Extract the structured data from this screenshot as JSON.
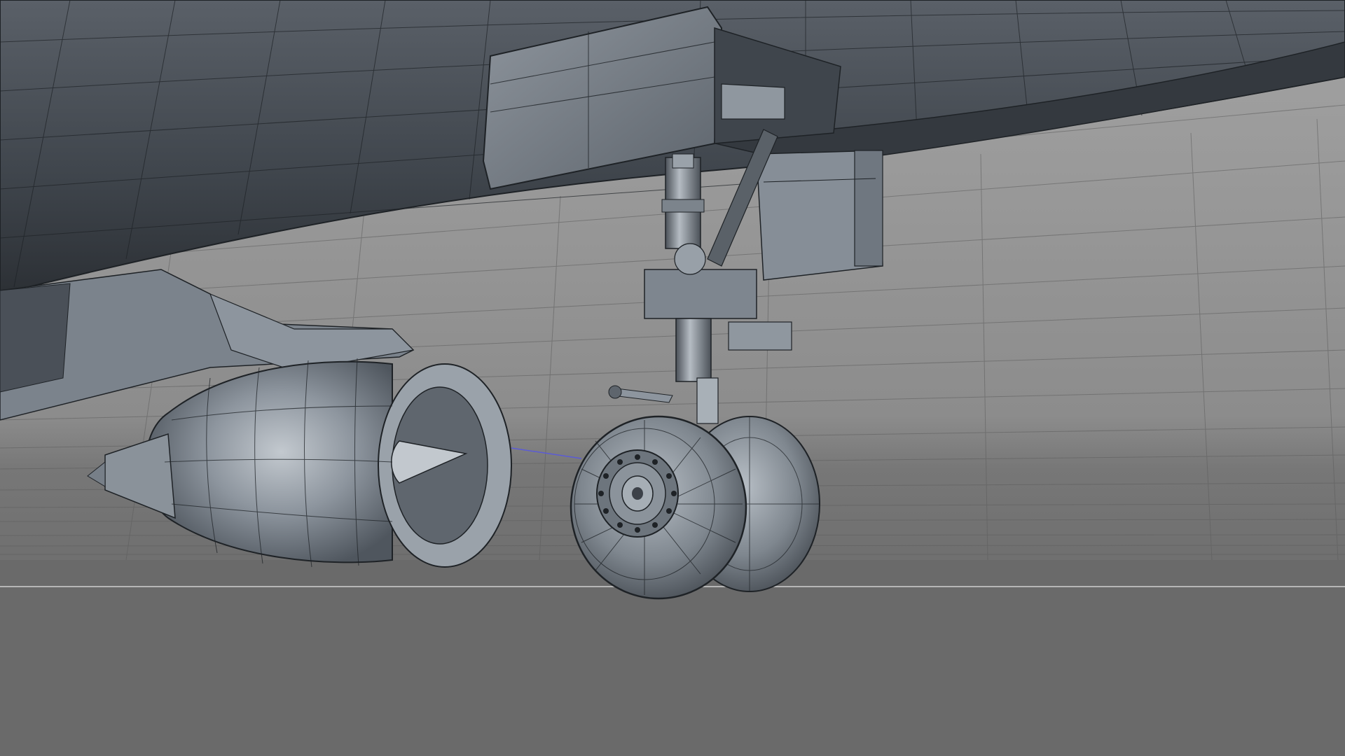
{
  "viewport": {
    "mode": "perspective",
    "shading": "gouraud-with-wireframe",
    "scene_objects": [
      "fuselage",
      "wing-root",
      "engine-nacelle",
      "main-landing-gear",
      "gear-door",
      "ground-plane"
    ]
  },
  "colors": {
    "background_far": "#8f8f8f",
    "floor": "#6a6a6a",
    "grid_line": "#5e5e5e",
    "fuselage": "#4a5058",
    "mesh_light": "#a9b0b8",
    "mesh_mid": "#7d858e",
    "mesh_dark": "#3c4148",
    "wire": "#1e2226",
    "horizon": "#d2d2d2",
    "axis_line": "#5b5bd6"
  },
  "icons": [
    "tire-icon",
    "hub-icon",
    "engine-spinner-icon"
  ]
}
